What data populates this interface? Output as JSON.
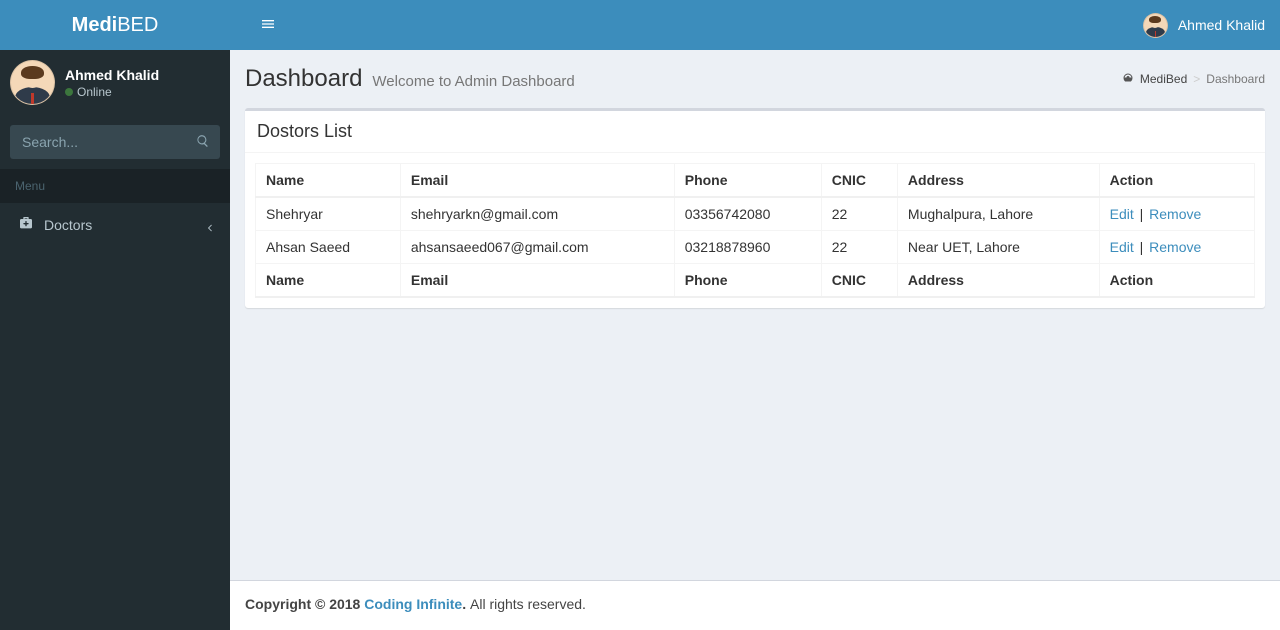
{
  "brand": {
    "bold": "Medi",
    "light": "BED"
  },
  "header": {
    "user_name": "Ahmed Khalid"
  },
  "sidebar": {
    "user_name": "Ahmed Khalid",
    "status": "Online",
    "search_placeholder": "Search...",
    "menu_header": "Menu",
    "items": [
      {
        "label": "Doctors"
      }
    ]
  },
  "page": {
    "title": "Dashboard",
    "subtitle": "Welcome to Admin Dashboard",
    "breadcrumb": {
      "root": "MediBed",
      "current": "Dashboard"
    }
  },
  "box": {
    "title": "Dostors List",
    "columns": {
      "name": "Name",
      "email": "Email",
      "phone": "Phone",
      "cnic": "CNIC",
      "address": "Address",
      "action": "Action"
    },
    "action_labels": {
      "edit": "Edit",
      "remove": "Remove"
    },
    "rows": [
      {
        "name": "Shehryar",
        "email": "shehryarkn@gmail.com",
        "phone": "03356742080",
        "cnic": "22",
        "address": "Mughalpura, Lahore"
      },
      {
        "name": "Ahsan Saeed",
        "email": "ahsansaeed067@gmail.com",
        "phone": "03218878960",
        "cnic": "22",
        "address": "Near UET, Lahore"
      }
    ]
  },
  "footer": {
    "prefix": "Copyright © 2018 ",
    "link": "Coding Infinite",
    "suffix": ". ",
    "rights": "All rights reserved."
  }
}
